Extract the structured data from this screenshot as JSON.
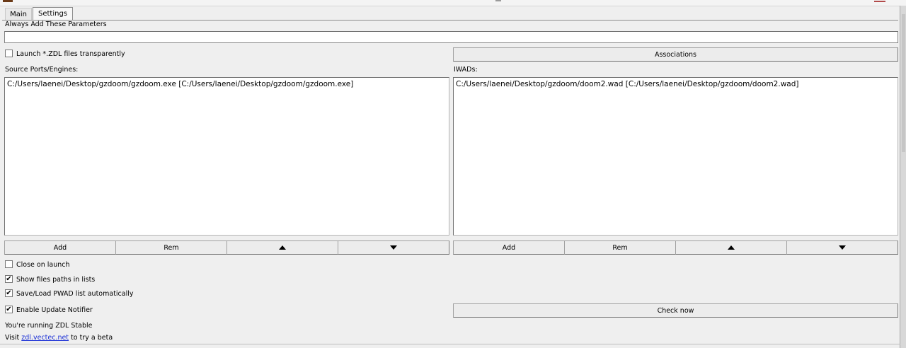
{
  "tabs": [
    {
      "label": "Main"
    },
    {
      "label": "Settings"
    }
  ],
  "always_params": {
    "label": "Always Add These Parameters",
    "value": ""
  },
  "launch_zdl": {
    "label": "Launch *.ZDL files transparently",
    "checked": false
  },
  "associations_label": "Associations",
  "source_ports": {
    "label": "Source Ports/Engines:",
    "items": [
      "C:/Users/laenei/Desktop/gzdoom/gzdoom.exe [C:/Users/laenei/Desktop/gzdoom/gzdoom.exe]"
    ],
    "add_label": "Add",
    "rem_label": "Rem"
  },
  "iwads": {
    "label": "IWADs:",
    "items": [
      "C:/Users/laenei/Desktop/gzdoom/doom2.wad [C:/Users/laenei/Desktop/gzdoom/doom2.wad]"
    ],
    "add_label": "Add",
    "rem_label": "Rem"
  },
  "options": {
    "close_on_launch": {
      "label": "Close on launch",
      "checked": false
    },
    "show_paths": {
      "label": "Show files paths in lists",
      "checked": true
    },
    "save_load_pwad": {
      "label": "Save/Load PWAD list automatically",
      "checked": true
    },
    "update_notifier": {
      "label": "Enable Update Notifier",
      "checked": true
    }
  },
  "check_now_label": "Check now",
  "status": {
    "running": "You're running ZDL Stable",
    "visit_prefix": "Visit ",
    "visit_link": "zdl.vectec.net",
    "visit_suffix": " to try a beta"
  },
  "icons": {
    "move_up": "triangle-up-icon",
    "move_down": "triangle-down-icon",
    "check": "checkmark-icon"
  },
  "colors": {
    "window_bg": "#efefef",
    "link": "#1a2fd6",
    "list_bg": "#ffffff"
  }
}
